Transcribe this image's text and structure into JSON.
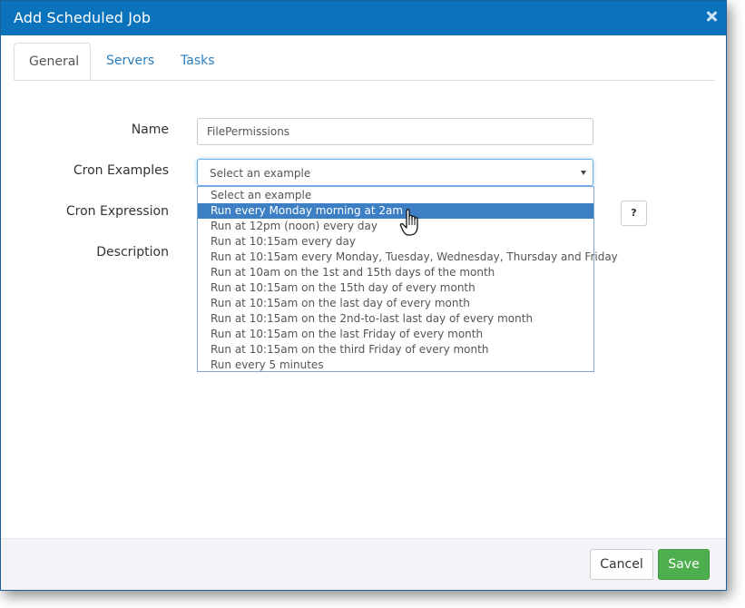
{
  "dialog": {
    "title": "Add Scheduled Job"
  },
  "tabs": [
    {
      "label": "General",
      "active": true
    },
    {
      "label": "Servers",
      "active": false
    },
    {
      "label": "Tasks",
      "active": false
    }
  ],
  "form": {
    "name_label": "Name",
    "name_value": "FilePermissions",
    "cron_examples_label": "Cron Examples",
    "cron_examples_selected": "Select an example",
    "cron_expression_label": "Cron Expression",
    "help_label": "?",
    "description_label": "Description"
  },
  "dropdown": {
    "options": [
      "Select an example",
      "Run every Monday morning at 2am",
      "Run at 12pm (noon) every day",
      "Run at 10:15am every day",
      "Run at 10:15am every Monday, Tuesday, Wednesday, Thursday and Friday",
      "Run at 10am on the 1st and 15th days of the month",
      "Run at 10:15am on the 15th day of every month",
      "Run at 10:15am on the last day of every month",
      "Run at 10:15am on the 2nd-to-last last day of every month",
      "Run at 10:15am on the last Friday of every month",
      "Run at 10:15am on the third Friday of every month",
      "Run every 5 minutes"
    ],
    "highlighted_index": 1
  },
  "footer": {
    "cancel_label": "Cancel",
    "save_label": "Save"
  },
  "colors": {
    "header": "#0b73bb",
    "highlight": "#3d7fc4",
    "save": "#4cae4c"
  },
  "icons": {
    "close": "close-icon",
    "caret": "caret-down-icon",
    "cursor": "hand-pointer-icon"
  }
}
